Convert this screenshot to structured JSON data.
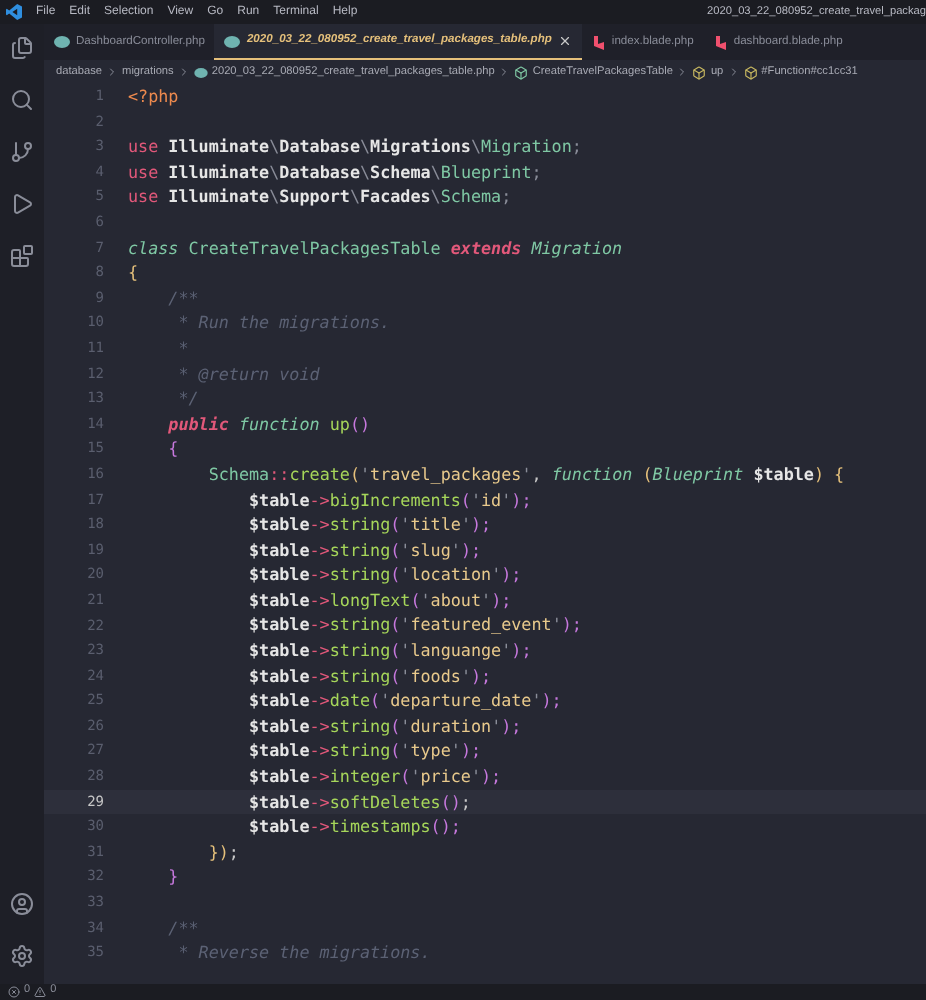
{
  "menu": [
    "File",
    "Edit",
    "Selection",
    "View",
    "Go",
    "Run",
    "Terminal",
    "Help"
  ],
  "window": {
    "title": "2020_03_22_080952_create_travel_packag"
  },
  "tabs": [
    {
      "label": "DashboardController.php",
      "kind": "php",
      "selected": false
    },
    {
      "label": "2020_03_22_080952_create_travel_packages_table.php",
      "kind": "php",
      "selected": true
    },
    {
      "label": "index.blade.php",
      "kind": "blade",
      "selected": false
    },
    {
      "label": "dashboard.blade.php",
      "kind": "blade",
      "selected": false
    }
  ],
  "breadcrumbs": [
    {
      "label": "database",
      "kind": "folder"
    },
    {
      "label": "migrations",
      "kind": "folder"
    },
    {
      "label": "2020_03_22_080952_create_travel_packages_table.php",
      "kind": "file"
    },
    {
      "label": "CreateTravelPackagesTable",
      "kind": "class"
    },
    {
      "label": "up",
      "kind": "method"
    },
    {
      "label": "#Function#cc1cc31",
      "kind": "method"
    }
  ],
  "lines": [
    {
      "number": "1",
      "current": false,
      "tokens": [
        {
          "text": "<?php",
          "kind": "tag"
        }
      ]
    },
    {
      "number": "2",
      "current": false
    },
    {
      "number": "3",
      "current": false,
      "tokens": [
        {
          "text": "use",
          "kind": "kw"
        },
        {
          "text": " Illuminate",
          "kind": "ns"
        },
        {
          "text": "\\",
          "kind": "op"
        },
        {
          "text": "Database",
          "kind": "ns"
        },
        {
          "text": "\\",
          "kind": "op"
        },
        {
          "text": "Migrations",
          "kind": "ns"
        },
        {
          "text": "\\",
          "kind": "op"
        },
        {
          "text": "Migration",
          "kind": "cls"
        },
        {
          "text": ";",
          "kind": "op"
        }
      ]
    },
    {
      "number": "4",
      "current": false,
      "tokens": [
        {
          "text": "use",
          "kind": "kw"
        },
        {
          "text": " Illuminate",
          "kind": "ns"
        },
        {
          "text": "\\",
          "kind": "op"
        },
        {
          "text": "Database",
          "kind": "ns"
        },
        {
          "text": "\\",
          "kind": "op"
        },
        {
          "text": "Schema",
          "kind": "ns"
        },
        {
          "text": "\\",
          "kind": "op"
        },
        {
          "text": "Blueprint",
          "kind": "cls"
        },
        {
          "text": ";",
          "kind": "op"
        }
      ]
    },
    {
      "number": "5",
      "current": false,
      "tokens": [
        {
          "text": "use",
          "kind": "kw"
        },
        {
          "text": " Illuminate",
          "kind": "ns"
        },
        {
          "text": "\\",
          "kind": "op"
        },
        {
          "text": "Support",
          "kind": "ns"
        },
        {
          "text": "\\",
          "kind": "op"
        },
        {
          "text": "Facades",
          "kind": "ns"
        },
        {
          "text": "\\",
          "kind": "op"
        },
        {
          "text": "Schema",
          "kind": "cls"
        },
        {
          "text": ";",
          "kind": "op"
        }
      ]
    },
    {
      "number": "6",
      "current": false
    },
    {
      "number": "7",
      "current": false,
      "tokens": [
        {
          "text": "class",
          "kind": "clsi"
        },
        {
          "text": " CreateTravelPackagesTable ",
          "kind": "cls"
        },
        {
          "text": "extends",
          "kind": "kwi"
        },
        {
          "text": " Migration",
          "kind": "clsi"
        }
      ]
    },
    {
      "number": "8",
      "current": false,
      "tokens": [
        {
          "text": "{",
          "kind": "brace"
        }
      ]
    },
    {
      "number": "9",
      "current": false,
      "tokens": [
        {
          "text": "    /**",
          "kind": "cmt"
        }
      ]
    },
    {
      "number": "10",
      "current": false,
      "tokens": [
        {
          "text": "     * Run the migrations.",
          "kind": "cmt"
        }
      ]
    },
    {
      "number": "11",
      "current": false,
      "tokens": [
        {
          "text": "     *",
          "kind": "cmt"
        }
      ]
    },
    {
      "number": "12",
      "current": false,
      "tokens": [
        {
          "text": "     * @return void",
          "kind": "cmt"
        }
      ]
    },
    {
      "number": "13",
      "current": false,
      "tokens": [
        {
          "text": "     */",
          "kind": "cmt"
        }
      ]
    },
    {
      "number": "14",
      "current": false,
      "tokens": [
        {
          "text": "    public",
          "kind": "kwi"
        },
        {
          "text": " function",
          "kind": "fnkw"
        },
        {
          "text": " up",
          "kind": "fn"
        },
        {
          "text": "()",
          "kind": "purple"
        }
      ]
    },
    {
      "number": "15",
      "current": false,
      "tokens": [
        {
          "text": "    {",
          "kind": "purple"
        }
      ]
    },
    {
      "number": "16",
      "current": false,
      "tokens": [
        {
          "text": "        Schema",
          "kind": "cls"
        },
        {
          "text": "::",
          "kind": "kw"
        },
        {
          "text": "create",
          "kind": "fn"
        },
        {
          "text": "(",
          "kind": "brace"
        },
        {
          "text": "'",
          "kind": "op"
        },
        {
          "text": "travel_packages",
          "kind": "str"
        },
        {
          "text": "'",
          "kind": "op"
        },
        {
          "text": ", ",
          "kind": "plain"
        },
        {
          "text": "function",
          "kind": "fnkw"
        },
        {
          "text": " (",
          "kind": "brace"
        },
        {
          "text": "Blueprint",
          "kind": "clsi"
        },
        {
          "text": " $table",
          "kind": "var"
        },
        {
          "text": ") {",
          "kind": "brace"
        }
      ]
    },
    {
      "number": "17",
      "current": false,
      "tokens": [
        {
          "text": "            $table",
          "kind": "var"
        },
        {
          "text": "->",
          "kind": "kw"
        },
        {
          "text": "bigIncrements",
          "kind": "fn"
        },
        {
          "text": "(",
          "kind": "purple"
        },
        {
          "text": "'",
          "kind": "op"
        },
        {
          "text": "id",
          "kind": "str"
        },
        {
          "text": "'",
          "kind": "op"
        },
        {
          "text": ");",
          "kind": "purple"
        }
      ]
    },
    {
      "number": "18",
      "current": false,
      "tokens": [
        {
          "text": "            $table",
          "kind": "var"
        },
        {
          "text": "->",
          "kind": "kw"
        },
        {
          "text": "string",
          "kind": "fn"
        },
        {
          "text": "(",
          "kind": "purple"
        },
        {
          "text": "'",
          "kind": "op"
        },
        {
          "text": "title",
          "kind": "str"
        },
        {
          "text": "'",
          "kind": "op"
        },
        {
          "text": ");",
          "kind": "purple"
        }
      ]
    },
    {
      "number": "19",
      "current": false,
      "tokens": [
        {
          "text": "            $table",
          "kind": "var"
        },
        {
          "text": "->",
          "kind": "kw"
        },
        {
          "text": "string",
          "kind": "fn"
        },
        {
          "text": "(",
          "kind": "purple"
        },
        {
          "text": "'",
          "kind": "op"
        },
        {
          "text": "slug",
          "kind": "str"
        },
        {
          "text": "'",
          "kind": "op"
        },
        {
          "text": ");",
          "kind": "purple"
        }
      ]
    },
    {
      "number": "20",
      "current": false,
      "tokens": [
        {
          "text": "            $table",
          "kind": "var"
        },
        {
          "text": "->",
          "kind": "kw"
        },
        {
          "text": "string",
          "kind": "fn"
        },
        {
          "text": "(",
          "kind": "purple"
        },
        {
          "text": "'",
          "kind": "op"
        },
        {
          "text": "location",
          "kind": "str"
        },
        {
          "text": "'",
          "kind": "op"
        },
        {
          "text": ");",
          "kind": "purple"
        }
      ]
    },
    {
      "number": "21",
      "current": false,
      "tokens": [
        {
          "text": "            $table",
          "kind": "var"
        },
        {
          "text": "->",
          "kind": "kw"
        },
        {
          "text": "longText",
          "kind": "fn"
        },
        {
          "text": "(",
          "kind": "purple"
        },
        {
          "text": "'",
          "kind": "op"
        },
        {
          "text": "about",
          "kind": "str"
        },
        {
          "text": "'",
          "kind": "op"
        },
        {
          "text": ");",
          "kind": "purple"
        }
      ]
    },
    {
      "number": "22",
      "current": false,
      "tokens": [
        {
          "text": "            $table",
          "kind": "var"
        },
        {
          "text": "->",
          "kind": "kw"
        },
        {
          "text": "string",
          "kind": "fn"
        },
        {
          "text": "(",
          "kind": "purple"
        },
        {
          "text": "'",
          "kind": "op"
        },
        {
          "text": "featured_event",
          "kind": "str"
        },
        {
          "text": "'",
          "kind": "op"
        },
        {
          "text": ");",
          "kind": "purple"
        }
      ]
    },
    {
      "number": "23",
      "current": false,
      "tokens": [
        {
          "text": "            $table",
          "kind": "var"
        },
        {
          "text": "->",
          "kind": "kw"
        },
        {
          "text": "string",
          "kind": "fn"
        },
        {
          "text": "(",
          "kind": "purple"
        },
        {
          "text": "'",
          "kind": "op"
        },
        {
          "text": "languange",
          "kind": "str"
        },
        {
          "text": "'",
          "kind": "op"
        },
        {
          "text": ");",
          "kind": "purple"
        }
      ]
    },
    {
      "number": "24",
      "current": false,
      "tokens": [
        {
          "text": "            $table",
          "kind": "var"
        },
        {
          "text": "->",
          "kind": "kw"
        },
        {
          "text": "string",
          "kind": "fn"
        },
        {
          "text": "(",
          "kind": "purple"
        },
        {
          "text": "'",
          "kind": "op"
        },
        {
          "text": "foods",
          "kind": "str"
        },
        {
          "text": "'",
          "kind": "op"
        },
        {
          "text": ");",
          "kind": "purple"
        }
      ]
    },
    {
      "number": "25",
      "current": false,
      "tokens": [
        {
          "text": "            $table",
          "kind": "var"
        },
        {
          "text": "->",
          "kind": "kw"
        },
        {
          "text": "date",
          "kind": "fn"
        },
        {
          "text": "(",
          "kind": "purple"
        },
        {
          "text": "'",
          "kind": "op"
        },
        {
          "text": "departure_date",
          "kind": "str"
        },
        {
          "text": "'",
          "kind": "op"
        },
        {
          "text": ");",
          "kind": "purple"
        }
      ]
    },
    {
      "number": "26",
      "current": false,
      "tokens": [
        {
          "text": "            $table",
          "kind": "var"
        },
        {
          "text": "->",
          "kind": "kw"
        },
        {
          "text": "string",
          "kind": "fn"
        },
        {
          "text": "(",
          "kind": "purple"
        },
        {
          "text": "'",
          "kind": "op"
        },
        {
          "text": "duration",
          "kind": "str"
        },
        {
          "text": "'",
          "kind": "op"
        },
        {
          "text": ");",
          "kind": "purple"
        }
      ]
    },
    {
      "number": "27",
      "current": false,
      "tokens": [
        {
          "text": "            $table",
          "kind": "var"
        },
        {
          "text": "->",
          "kind": "kw"
        },
        {
          "text": "string",
          "kind": "fn"
        },
        {
          "text": "(",
          "kind": "purple"
        },
        {
          "text": "'",
          "kind": "op"
        },
        {
          "text": "type",
          "kind": "str"
        },
        {
          "text": "'",
          "kind": "op"
        },
        {
          "text": ");",
          "kind": "purple"
        }
      ]
    },
    {
      "number": "28",
      "current": false,
      "tokens": [
        {
          "text": "            $table",
          "kind": "var"
        },
        {
          "text": "->",
          "kind": "kw"
        },
        {
          "text": "integer",
          "kind": "fn"
        },
        {
          "text": "(",
          "kind": "purple"
        },
        {
          "text": "'",
          "kind": "op"
        },
        {
          "text": "price",
          "kind": "str"
        },
        {
          "text": "'",
          "kind": "op"
        },
        {
          "text": ");",
          "kind": "purple"
        }
      ]
    },
    {
      "number": "29",
      "current": true,
      "tokens": [
        {
          "text": "            $table",
          "kind": "var"
        },
        {
          "text": "->",
          "kind": "kw"
        },
        {
          "text": "softDeletes",
          "kind": "fn"
        },
        {
          "text": "()",
          "kind": "purple"
        },
        {
          "text": ";",
          "kind": "plain"
        }
      ]
    },
    {
      "number": "30",
      "current": false,
      "tokens": [
        {
          "text": "            $table",
          "kind": "var"
        },
        {
          "text": "->",
          "kind": "kw"
        },
        {
          "text": "timestamps",
          "kind": "fn"
        },
        {
          "text": "();",
          "kind": "purple"
        }
      ]
    },
    {
      "number": "31",
      "current": false,
      "tokens": [
        {
          "text": "        })",
          "kind": "brace"
        },
        {
          "text": ";",
          "kind": "plain"
        }
      ]
    },
    {
      "number": "32",
      "current": false,
      "tokens": [
        {
          "text": "    }",
          "kind": "purple"
        }
      ]
    },
    {
      "number": "33",
      "current": false
    },
    {
      "number": "34",
      "current": false,
      "tokens": [
        {
          "text": "    /**",
          "kind": "cmt"
        }
      ]
    },
    {
      "number": "35",
      "current": false,
      "tokens": [
        {
          "text": "     * Reverse the migrations.",
          "kind": "cmt"
        }
      ]
    }
  ],
  "status_bar": {
    "errors": "0",
    "warnings": "0"
  }
}
